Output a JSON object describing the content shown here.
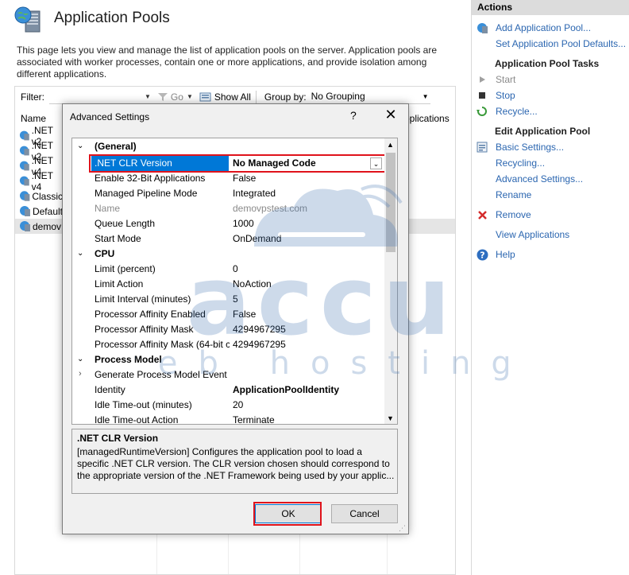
{
  "header": {
    "title": "Application Pools",
    "description": "This page lets you view and manage the list of application pools on the server. Application pools are associated with worker processes, contain one or more applications, and provide isolation among different applications."
  },
  "filterbar": {
    "filter_label": "Filter:",
    "go_label": "Go",
    "show_all_label": "Show All",
    "group_by_label": "Group by:",
    "group_by_value": "No Grouping"
  },
  "list": {
    "col_name": "Name",
    "col_apps": "pplications",
    "rows": [
      ".NET v2",
      ".NET v2",
      ".NET v4",
      ".NET v4",
      "Classic",
      "Default",
      "demov"
    ]
  },
  "actions": {
    "title": "Actions",
    "add": "Add Application Pool...",
    "set_defaults": "Set Application Pool Defaults...",
    "tasks_head": "Application Pool Tasks",
    "start": "Start",
    "stop": "Stop",
    "recycle": "Recycle...",
    "edit_head": "Edit Application Pool",
    "basic": "Basic Settings...",
    "recycling": "Recycling...",
    "advanced": "Advanced Settings...",
    "rename": "Rename",
    "remove": "Remove",
    "view_apps": "View Applications",
    "help": "Help"
  },
  "watermark": {
    "brand_top": "accu",
    "brand_bottom": "web hosting"
  },
  "dialog": {
    "title": "Advanced Settings",
    "help_glyph": "?",
    "close_glyph": "✕",
    "sections": {
      "general": "(General)",
      "cpu": "CPU",
      "process_model": "Process Model"
    },
    "props": {
      "clr_label": ".NET CLR Version",
      "clr_value": "No Managed Code",
      "enable32_label": "Enable 32-Bit Applications",
      "enable32_value": "False",
      "pipeline_label": "Managed Pipeline Mode",
      "pipeline_value": "Integrated",
      "name_label": "Name",
      "name_value": "demovpstest.com",
      "queue_label": "Queue Length",
      "queue_value": "1000",
      "startmode_label": "Start Mode",
      "startmode_value": "OnDemand",
      "limit_label": "Limit (percent)",
      "limit_value": "0",
      "limitaction_label": "Limit Action",
      "limitaction_value": "NoAction",
      "limitint_label": "Limit Interval (minutes)",
      "limitint_value": "5",
      "affinity_label": "Processor Affinity Enabled",
      "affinity_value": "False",
      "mask_label": "Processor Affinity Mask",
      "mask_value": "4294967295",
      "mask64_label": "Processor Affinity Mask (64-bit c",
      "mask64_value": "4294967295",
      "genevent_label": "Generate Process Model Event L",
      "identity_label": "Identity",
      "identity_value": "ApplicationPoolIdentity",
      "idletimeout_label": "Idle Time-out (minutes)",
      "idletimeout_value": "20",
      "idleaction_label": "Idle Time-out Action",
      "idleaction_value": "Terminate"
    },
    "desc_title": ".NET CLR Version",
    "desc_text": "[managedRuntimeVersion] Configures the application pool to load a specific .NET CLR version.  The CLR version chosen should correspond to the appropriate version of the .NET Framework being used by your applic...",
    "ok_label": "OK",
    "cancel_label": "Cancel"
  }
}
